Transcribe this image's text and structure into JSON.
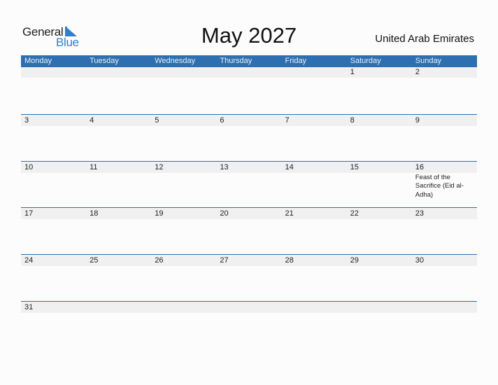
{
  "logo": {
    "line1": "General",
    "line2": "Blue",
    "accent_color": "#2f7fc9"
  },
  "header": {
    "title": "May 2027",
    "country": "United Arab Emirates"
  },
  "colors": {
    "header_bg": "#2e6fb1",
    "day_bg": "#f0f0f0"
  },
  "weekdays": [
    "Monday",
    "Tuesday",
    "Wednesday",
    "Thursday",
    "Friday",
    "Saturday",
    "Sunday"
  ],
  "weeks": [
    {
      "days": [
        {
          "num": "",
          "holiday": ""
        },
        {
          "num": "",
          "holiday": ""
        },
        {
          "num": "",
          "holiday": ""
        },
        {
          "num": "",
          "holiday": ""
        },
        {
          "num": "",
          "holiday": ""
        },
        {
          "num": "1",
          "holiday": ""
        },
        {
          "num": "2",
          "holiday": ""
        }
      ]
    },
    {
      "days": [
        {
          "num": "3",
          "holiday": ""
        },
        {
          "num": "4",
          "holiday": ""
        },
        {
          "num": "5",
          "holiday": ""
        },
        {
          "num": "6",
          "holiday": ""
        },
        {
          "num": "7",
          "holiday": ""
        },
        {
          "num": "8",
          "holiday": ""
        },
        {
          "num": "9",
          "holiday": ""
        }
      ]
    },
    {
      "days": [
        {
          "num": "10",
          "holiday": ""
        },
        {
          "num": "11",
          "holiday": ""
        },
        {
          "num": "12",
          "holiday": ""
        },
        {
          "num": "13",
          "holiday": ""
        },
        {
          "num": "14",
          "holiday": ""
        },
        {
          "num": "15",
          "holiday": ""
        },
        {
          "num": "16",
          "holiday": "Feast of the Sacrifice (Eid al-Adha)"
        }
      ]
    },
    {
      "days": [
        {
          "num": "17",
          "holiday": ""
        },
        {
          "num": "18",
          "holiday": ""
        },
        {
          "num": "19",
          "holiday": ""
        },
        {
          "num": "20",
          "holiday": ""
        },
        {
          "num": "21",
          "holiday": ""
        },
        {
          "num": "22",
          "holiday": ""
        },
        {
          "num": "23",
          "holiday": ""
        }
      ]
    },
    {
      "days": [
        {
          "num": "24",
          "holiday": ""
        },
        {
          "num": "25",
          "holiday": ""
        },
        {
          "num": "26",
          "holiday": ""
        },
        {
          "num": "27",
          "holiday": ""
        },
        {
          "num": "28",
          "holiday": ""
        },
        {
          "num": "29",
          "holiday": ""
        },
        {
          "num": "30",
          "holiday": ""
        }
      ]
    },
    {
      "days": [
        {
          "num": "31",
          "holiday": ""
        },
        {
          "num": "",
          "holiday": ""
        },
        {
          "num": "",
          "holiday": ""
        },
        {
          "num": "",
          "holiday": ""
        },
        {
          "num": "",
          "holiday": ""
        },
        {
          "num": "",
          "holiday": ""
        },
        {
          "num": "",
          "holiday": ""
        }
      ]
    }
  ]
}
